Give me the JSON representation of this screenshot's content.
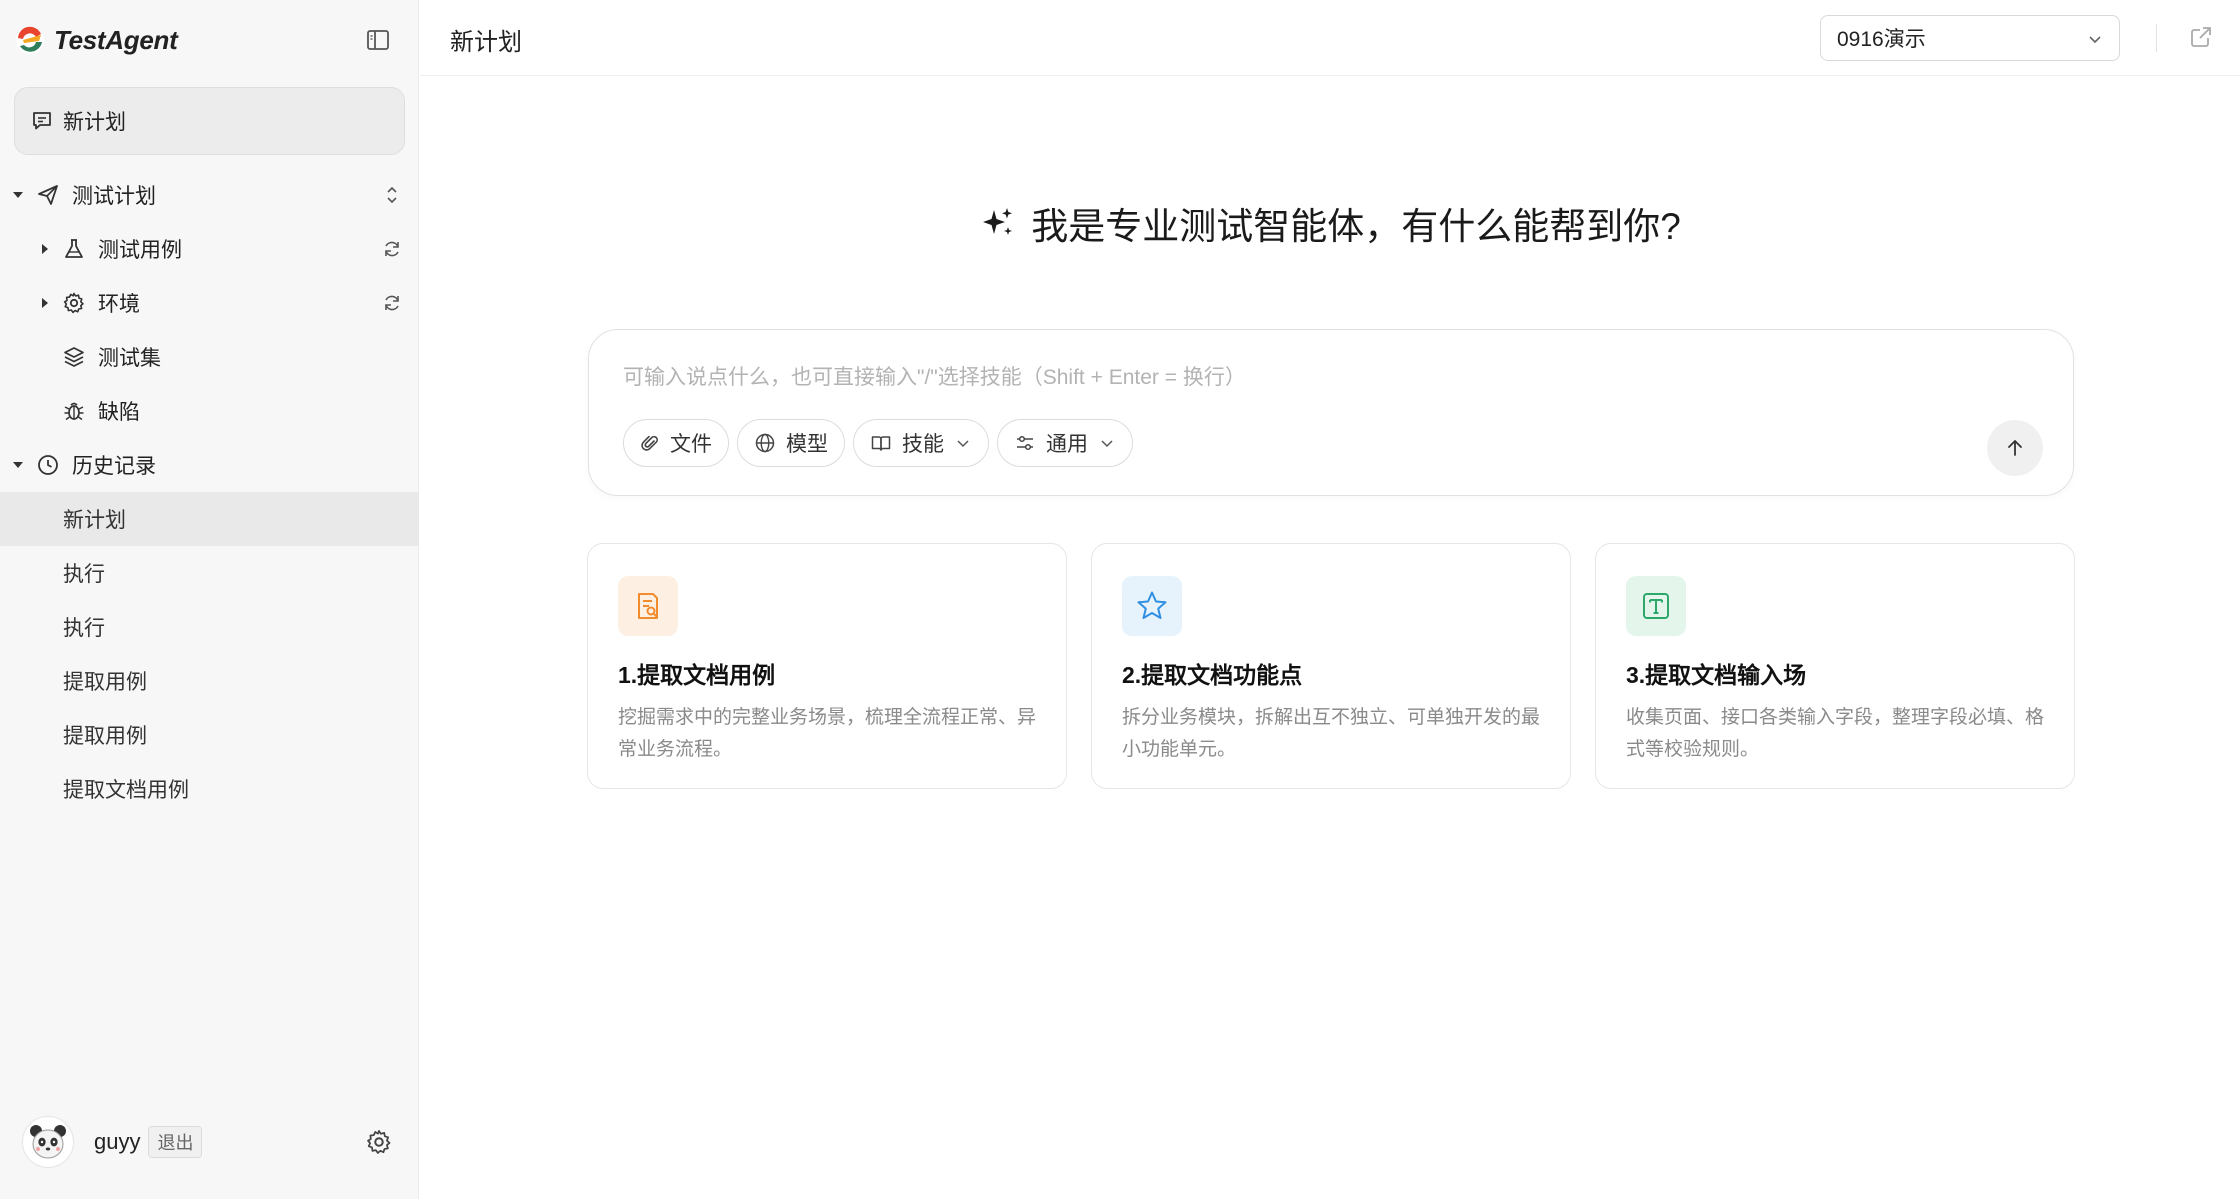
{
  "app": {
    "name": "TestAgent",
    "brand_colors": [
      "#e8442e",
      "#f5a623",
      "#2e7d5b"
    ]
  },
  "sidebar": {
    "new_plan_label": "新计划",
    "sections": [
      {
        "label": "测试计划",
        "icon": "send-icon"
      },
      {
        "label": "历史记录",
        "icon": "clock-icon"
      }
    ],
    "plan_items": [
      {
        "label": "测试用例",
        "icon": "flask-icon"
      },
      {
        "label": "环境",
        "icon": "gear-icon"
      },
      {
        "label": "测试集",
        "icon": "layers-icon"
      },
      {
        "label": "缺陷",
        "icon": "bug-icon"
      }
    ],
    "history": [
      "新计划",
      "执行",
      "执行",
      "提取用例",
      "提取用例",
      "提取文档用例"
    ],
    "user": {
      "name": "guyy",
      "logout_label": "退出"
    }
  },
  "header": {
    "title": "新计划",
    "project": "0916演示"
  },
  "main": {
    "hero_text": "我是专业测试智能体，有什么能帮到你?",
    "input_placeholder": "可输入说点什么，也可直接输入\"/\"选择技能（Shift + Enter = 换行）",
    "tools": [
      {
        "label": "文件",
        "icon": "paperclip-icon"
      },
      {
        "label": "模型",
        "icon": "globe-icon"
      },
      {
        "label": "技能",
        "icon": "book-icon"
      },
      {
        "label": "通用",
        "icon": "sliders-icon"
      }
    ],
    "cards": [
      {
        "title": "1.提取文档用例",
        "desc": "挖掘需求中的完整业务场景，梳理全流程正常、异常业务流程。",
        "icon": "document-search-icon",
        "color": "#f08c2e",
        "bg": "#fdf0e2"
      },
      {
        "title": "2.提取文档功能点",
        "desc": "拆分业务模块，拆解出互不独立、可单独开发的最小功能单元。",
        "icon": "star-icon",
        "color": "#2f8fe0",
        "bg": "#e6f3fd"
      },
      {
        "title": "3.提取文档输入场",
        "desc": "收集页面、接口各类输入字段，整理字段必填、格式等校验规则。",
        "icon": "text-box-icon",
        "color": "#2ea86a",
        "bg": "#e4f6ec"
      }
    ]
  }
}
